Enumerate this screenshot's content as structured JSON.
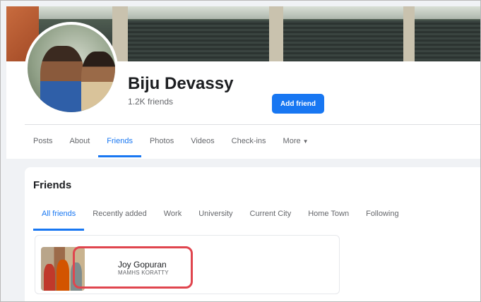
{
  "profile": {
    "name": "Biju Devassy",
    "friend_count": "1.2K friends"
  },
  "nav_tabs": [
    {
      "label": "Posts",
      "active": false
    },
    {
      "label": "About",
      "active": false
    },
    {
      "label": "Friends",
      "active": true
    },
    {
      "label": "Photos",
      "active": false
    },
    {
      "label": "Videos",
      "active": false
    },
    {
      "label": "Check-ins",
      "active": false
    },
    {
      "label": "More",
      "active": false
    }
  ],
  "friends_section": {
    "title": "Friends",
    "subtabs": [
      {
        "label": "All friends",
        "active": true
      },
      {
        "label": "Recently added",
        "active": false
      },
      {
        "label": "Work",
        "active": false
      },
      {
        "label": "University",
        "active": false
      },
      {
        "label": "Current City",
        "active": false
      },
      {
        "label": "Home Town",
        "active": false
      },
      {
        "label": "Following",
        "active": false
      }
    ],
    "friends": [
      {
        "name": "Joy Gopuran",
        "subtitle": "MAMHS KORATTY",
        "action_label": "Add friend"
      }
    ]
  },
  "colors": {
    "accent": "#1877f2",
    "highlight": "#e0454e",
    "page_bg": "#f0f2f5"
  },
  "icons": {
    "more_caret": "caret-down-icon"
  }
}
